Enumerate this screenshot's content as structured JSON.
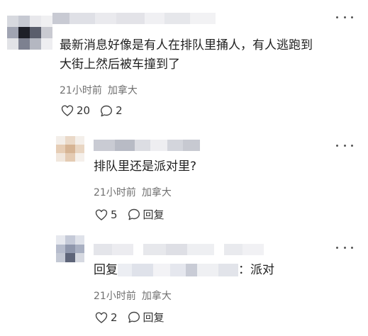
{
  "colors": {
    "background": "#ffffff",
    "text": "#1f1f1f",
    "meta": "#707070",
    "icon": "#444444"
  },
  "comments": [
    {
      "text_lines": [
        "最新消息好像是有人在排队里捅人，有人逃跑到",
        "大街上然后被车撞到了"
      ],
      "time": "21小时前",
      "location": "加拿大",
      "likes": "20",
      "replies": "2"
    },
    {
      "text_lines": [
        "排队里还是派对里?"
      ],
      "time": "21小时前",
      "location": "加拿大",
      "likes": "5",
      "reply_label": "回复"
    },
    {
      "reply_prefix": "回复",
      "reply_suffix": "：派对",
      "time": "21小时前",
      "location": "加拿大",
      "likes": "2",
      "reply_label": "回复"
    }
  ],
  "icons": {
    "more": "more-horizontal-icon",
    "like": "heart-outline-icon",
    "comment": "comment-bubble-icon"
  }
}
